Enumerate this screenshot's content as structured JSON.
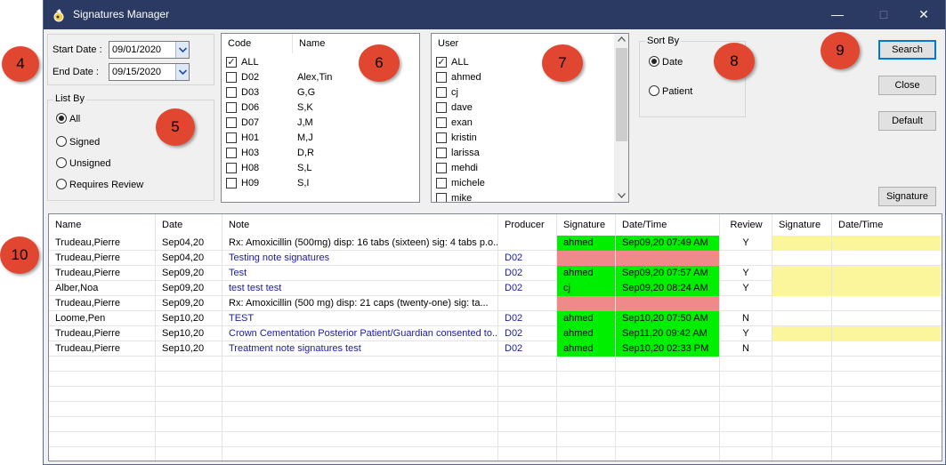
{
  "window": {
    "title": "Signatures Manager",
    "minimize_glyph": "—",
    "maximize_glyph": "□",
    "close_glyph": "✕"
  },
  "dates": {
    "start_label": "Start Date :",
    "start_value": "09/01/2020",
    "end_label": "End Date :",
    "end_value": "09/15/2020"
  },
  "list_by": {
    "label": "List By",
    "options": [
      "All",
      "Signed",
      "Unsigned",
      "Requires Review"
    ],
    "selected": "All"
  },
  "codes": {
    "code_header": "Code",
    "name_header": "Name",
    "all_label": "ALL",
    "all_checked": true,
    "rows": [
      {
        "code": "D02",
        "name": "Alex,Tin"
      },
      {
        "code": "D03",
        "name": "G,G"
      },
      {
        "code": "D06",
        "name": "S,K"
      },
      {
        "code": "D07",
        "name": "J,M"
      },
      {
        "code": "H01",
        "name": "M,J"
      },
      {
        "code": "H03",
        "name": "D,R"
      },
      {
        "code": "H08",
        "name": "S,L"
      },
      {
        "code": "H09",
        "name": "S,I"
      }
    ]
  },
  "users": {
    "header": "User",
    "all_label": "ALL",
    "all_checked": true,
    "rows": [
      "ahmed",
      "cj",
      "dave",
      "exan",
      "kristin",
      "larissa",
      "mehdi",
      "michele",
      "mike"
    ]
  },
  "sort_by": {
    "label": "Sort By",
    "options": [
      "Date",
      "Patient"
    ],
    "selected": "Date"
  },
  "buttons": {
    "search": "Search",
    "close": "Close",
    "default": "Default",
    "signature": "Signature"
  },
  "grid": {
    "headers": [
      "Name",
      "Date",
      "Note",
      "Producer",
      "Signature",
      "Date/Time",
      "Review",
      "Signature",
      "Date/Time"
    ],
    "rows": [
      {
        "name": "Trudeau,Pierre",
        "date": "Sep04,20",
        "note": "Rx: Amoxicillin (500mg)  disp: 16 tabs (sixteen)  sig: 4 tabs p.o...",
        "note_blue": false,
        "producer": "",
        "signature": "ahmed",
        "sig_status": "signed",
        "datetime": "Sep09,20 07:49 AM",
        "review": "Y",
        "review_pending": true
      },
      {
        "name": "Trudeau,Pierre",
        "date": "Sep04,20",
        "note": "Testing note signatures",
        "note_blue": true,
        "producer": "D02",
        "signature": "",
        "sig_status": "unsigned",
        "datetime": "",
        "review": "",
        "review_pending": false
      },
      {
        "name": "Trudeau,Pierre",
        "date": "Sep09,20",
        "note": "Test",
        "note_blue": true,
        "producer": "D02",
        "signature": "ahmed",
        "sig_status": "signed",
        "datetime": "Sep09,20 07:57 AM",
        "review": "Y",
        "review_pending": true
      },
      {
        "name": "Alber,Noa",
        "date": "Sep09,20",
        "note": "test test test",
        "note_blue": true,
        "producer": "D02",
        "signature": "cj",
        "sig_status": "signed",
        "datetime": "Sep09,20 08:24 AM",
        "review": "Y",
        "review_pending": true
      },
      {
        "name": "Trudeau,Pierre",
        "date": "Sep09,20",
        "note": "Rx: Amoxicillin  (500 mg)  disp: 21 caps (twenty-one)  sig:    ta...",
        "note_blue": false,
        "producer": "",
        "signature": "",
        "sig_status": "unsigned",
        "datetime": "",
        "review": "",
        "review_pending": false
      },
      {
        "name": "Loome,Pen",
        "date": "Sep10,20",
        "note": "TEST",
        "note_blue": true,
        "producer": "D02",
        "signature": "ahmed",
        "sig_status": "signed",
        "datetime": "Sep10,20 07:50 AM",
        "review": "N",
        "review_pending": false
      },
      {
        "name": "Trudeau,Pierre",
        "date": "Sep10,20",
        "note": "Crown Cementation Posterior  Patient/Guardian consented to...",
        "note_blue": true,
        "producer": "D02",
        "signature": "ahmed",
        "sig_status": "signed",
        "datetime": "Sep11,20 09:42 AM",
        "review": "Y",
        "review_pending": true
      },
      {
        "name": "Trudeau,Pierre",
        "date": "Sep10,20",
        "note": "Treatment note signatures test",
        "note_blue": true,
        "producer": "D02",
        "signature": "ahmed",
        "sig_status": "signed",
        "datetime": "Sep10,20 02:33 PM",
        "review": "N",
        "review_pending": false
      }
    ]
  },
  "callouts": [
    "4",
    "5",
    "6",
    "7",
    "8",
    "9",
    "10"
  ],
  "colors": {
    "titlebar": "#2b3a63",
    "signed": "#00ee00",
    "unsigned": "#f08a8a",
    "review_pending": "#fbf59b",
    "note_blue": "#1a1aa8",
    "callout": "#e14630"
  }
}
